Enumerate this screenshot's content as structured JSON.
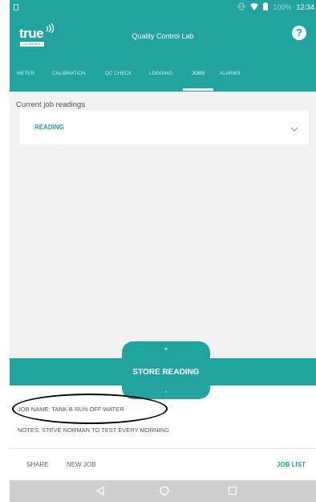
{
  "status_bar": {
    "battery": "100%",
    "time": "12:34"
  },
  "app_bar": {
    "logo_text": "true",
    "logo_sub": "pH SERIES",
    "title": "Quality Control Lab",
    "help_icon": "?"
  },
  "tabs": [
    {
      "label": "METER",
      "active": false
    },
    {
      "label": "CALIBRATION",
      "active": false
    },
    {
      "label": "QC CHECK",
      "active": false
    },
    {
      "label": "LOGGING",
      "active": false
    },
    {
      "label": "JOBS",
      "active": true
    },
    {
      "label": "ALARMS",
      "active": false
    }
  ],
  "main": {
    "section_label": "Current job readings",
    "dropdown_label": "READING"
  },
  "store": {
    "plus": "+",
    "label": "STORE READING",
    "minus": "-"
  },
  "job": {
    "name": "JOB NAME: TANK B RUN OFF WATER",
    "notes": "NOTES: STEVE NORMAN TO TEST EVERY MORNING"
  },
  "bottom_bar": {
    "share": "SHARE",
    "new_job": "NEW JOB",
    "job_list": "JOB LIST"
  },
  "colors": {
    "accent": "#22a39f",
    "content_bg": "#f2f2f2",
    "nav_bg": "#cfcfcf"
  },
  "icons": [
    "sim-card-icon",
    "vibrate-icon",
    "wifi-icon",
    "battery-icon",
    "help-icon",
    "chevron-down-icon",
    "back-icon",
    "home-icon",
    "recents-icon"
  ]
}
